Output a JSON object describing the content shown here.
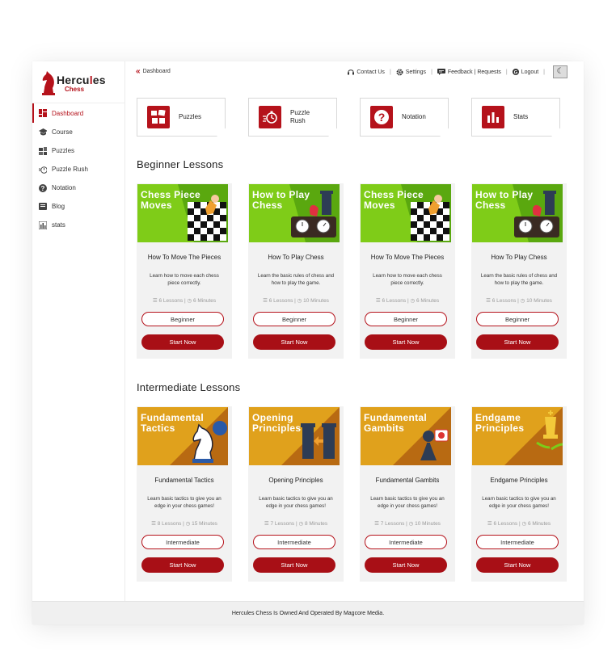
{
  "brand": {
    "line1": "Hercu",
    "line1b": "es",
    "line2": "Chess"
  },
  "colors": {
    "accent": "#b5121b",
    "green": "#7ccc1a",
    "orange": "#e3a11a"
  },
  "sidebar": {
    "items": [
      {
        "label": "Dashboard",
        "icon": "dashboard-icon",
        "active": true
      },
      {
        "label": "Course",
        "icon": "graduation-cap-icon"
      },
      {
        "label": "Puzzles",
        "icon": "puzzles-icon"
      },
      {
        "label": "Puzzle Rush",
        "icon": "stopwatch-icon"
      },
      {
        "label": "Notation",
        "icon": "question-icon"
      },
      {
        "label": "Blog",
        "icon": "blog-icon"
      },
      {
        "label": "stats",
        "icon": "stats-icon"
      }
    ]
  },
  "topbar": {
    "breadcrumb": "Dashboard",
    "contact": "Contact Us",
    "settings": "Settings",
    "feedback": "Feedback | Requests",
    "logout": "Logout"
  },
  "features": [
    {
      "label": "Puzzles",
      "icon": "puzzle-pieces-icon"
    },
    {
      "label": "Puzzle\nRush",
      "icon": "stopwatch-icon"
    },
    {
      "label": "Notation",
      "icon": "question-icon"
    },
    {
      "label": "Stats",
      "icon": "bar-chart-icon"
    }
  ],
  "beginner": {
    "heading": "Beginner Lessons",
    "cards": [
      {
        "thumb_title": "Chess Piece\nMoves",
        "title": "How To Move The Pieces",
        "desc": "Learn how to move each chess piece correctly.",
        "lessons": "6 Lessons",
        "duration": "6 Minutes",
        "level": "Beginner",
        "cta": "Start Now",
        "art": "board"
      },
      {
        "thumb_title": "How to Play\nChess",
        "title": "How To Play Chess",
        "desc": "Learn the basic rules of chess and how to play the game.",
        "lessons": "6 Lessons",
        "duration": "10 Minutes",
        "level": "Beginner",
        "cta": "Start Now",
        "art": "clock"
      },
      {
        "thumb_title": "Chess Piece\nMoves",
        "title": "How To Move The Pieces",
        "desc": "Learn how to move each chess piece correctly.",
        "lessons": "6 Lessons",
        "duration": "6 Minutes",
        "level": "Beginner",
        "cta": "Start Now",
        "art": "board"
      },
      {
        "thumb_title": "How to Play\nChess",
        "title": "How To Play Chess",
        "desc": "Learn the basic rules of chess and how to play the game.",
        "lessons": "6 Lessons",
        "duration": "10 Minutes",
        "level": "Beginner",
        "cta": "Start Now",
        "art": "clock"
      }
    ]
  },
  "intermediate": {
    "heading": "Intermediate Lessons",
    "cards": [
      {
        "thumb_title": "Fundamental\nTactics",
        "title": "Fundamental Tactics",
        "desc": "Learn basic tactics to give you an edge in your chess games!",
        "lessons": "8 Lessons",
        "duration": "15 Minutes",
        "level": "Intermediate",
        "cta": "Start Now",
        "art": "knight"
      },
      {
        "thumb_title": "Opening\nPrinciples",
        "title": "Opening Principles",
        "desc": "Learn basic tactics to give you an edge in your chess games!",
        "lessons": "7 Lessons",
        "duration": "8 Minutes",
        "level": "Intermediate",
        "cta": "Start Now",
        "art": "rooks"
      },
      {
        "thumb_title": "Fundamental\nGambits",
        "title": "Fundamental Gambits",
        "desc": "Learn basic tactics to give you an edge in your chess games!",
        "lessons": "7 Lessons",
        "duration": "10 Minutes",
        "level": "Intermediate",
        "cta": "Start Now",
        "art": "pawn"
      },
      {
        "thumb_title": "Endgame\nPrinciples",
        "title": "Endgame Principles",
        "desc": "Learn basic tactics to give you an edge in your chess games!",
        "lessons": "6 Lessons",
        "duration": "6 Minutes",
        "level": "Intermediate",
        "cta": "Start Now",
        "art": "king"
      }
    ]
  },
  "footer": "Hercules Chess Is Owned And Operated By Magcore Media."
}
